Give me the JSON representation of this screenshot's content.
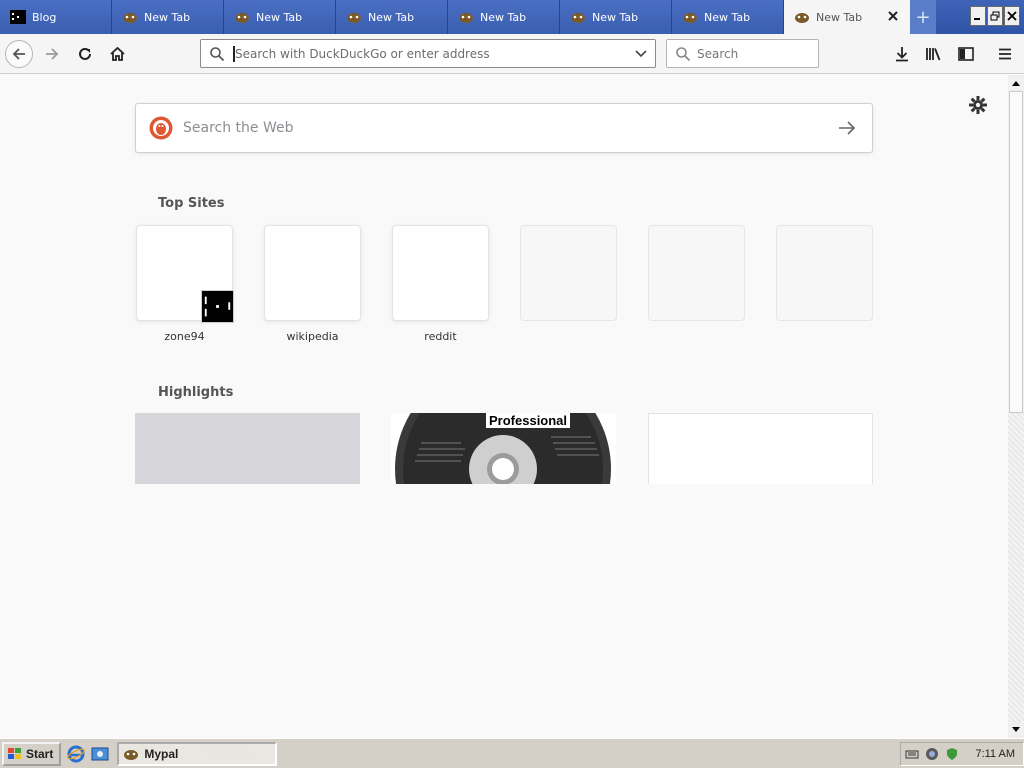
{
  "tabs": [
    {
      "title": "Blog",
      "icon": "blog-favicon"
    },
    {
      "title": "New Tab",
      "icon": "mypal-icon"
    },
    {
      "title": "New Tab",
      "icon": "mypal-icon"
    },
    {
      "title": "New Tab",
      "icon": "mypal-icon"
    },
    {
      "title": "New Tab",
      "icon": "mypal-icon"
    },
    {
      "title": "New Tab",
      "icon": "mypal-icon"
    },
    {
      "title": "New Tab",
      "icon": "mypal-icon"
    }
  ],
  "active_tab": {
    "title": "New Tab",
    "icon": "mypal-icon"
  },
  "newtab_label": "+",
  "urlbar": {
    "placeholder": "Search with DuckDuckGo or enter address",
    "value": ""
  },
  "searchbar": {
    "placeholder": "Search"
  },
  "page": {
    "search_placeholder": "Search the Web",
    "topsites_title": "Top Sites",
    "highlights_title": "Highlights",
    "topsites": [
      {
        "label": "zone94"
      },
      {
        "label": "wikipedia"
      },
      {
        "label": "reddit"
      },
      {
        "label": ""
      },
      {
        "label": ""
      },
      {
        "label": ""
      }
    ],
    "highlight_text": "Professional"
  },
  "taskbar": {
    "start_label": "Start",
    "task_label": "Mypal",
    "clock": "7:11 AM"
  },
  "colors": {
    "tabstrip": "#3a5fb1",
    "content_bg": "#f9f9fa",
    "taskbar": "#d4d0c8"
  }
}
